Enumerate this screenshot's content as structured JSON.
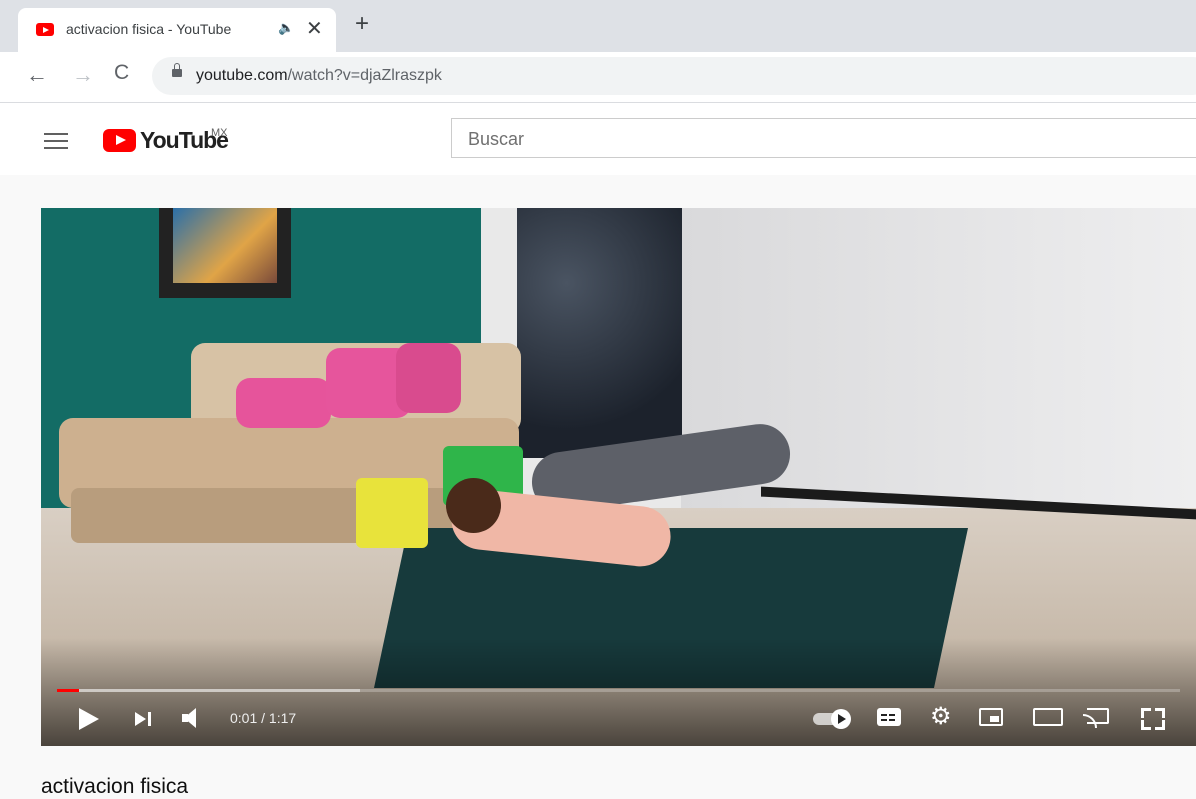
{
  "browser": {
    "tab": {
      "title": "activacion fisica - YouTube",
      "audio_icon": "speaker-icon",
      "close_symbol": "✕"
    },
    "new_tab_symbol": "+",
    "nav": {
      "back": "←",
      "forward": "→",
      "reload": "C"
    },
    "address_bar": {
      "host": "youtube.com",
      "path": "/watch?v=djaZlraszpk"
    }
  },
  "youtube": {
    "logo_text": "YouTube",
    "country_code": "MX",
    "search_placeholder": "Buscar",
    "brand_color": "#ff0000"
  },
  "player": {
    "time_display": "0:01 / 1:17",
    "progress_played": 0.02,
    "progress_loaded": 0.27,
    "controls": [
      "play-icon",
      "next-icon",
      "volume-icon",
      "autoplay-toggle-icon",
      "subtitles-icon",
      "settings-icon",
      "miniplayer-icon",
      "theater-mode-icon",
      "cast-icon",
      "fullscreen-icon"
    ]
  },
  "video": {
    "title": "activacion fisica"
  }
}
